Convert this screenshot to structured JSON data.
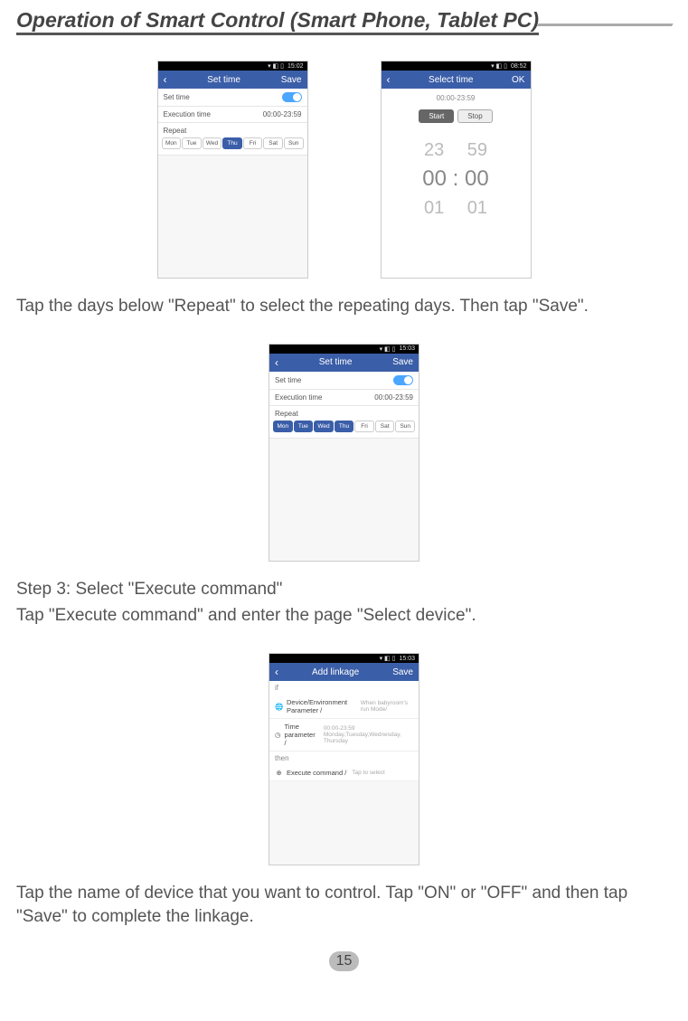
{
  "page_title": "Operation of Smart Control (Smart Phone, Tablet PC)",
  "page_number": "15",
  "texts": {
    "t1": "Tap the days below \"Repeat\" to select the repeating days. Then tap \"Save\".",
    "t2": "Step 3: Select \"Execute command\"",
    "t3": "Tap \"Execute command\" and enter the page \"Select device\".",
    "t4": "Tap the name of device that you want to control. Tap \"ON\" or \"OFF\" and then tap \"Save\" to complete the linkage."
  },
  "shot_a": {
    "status_time": "15:02",
    "title": "Set time",
    "save": "Save",
    "set_time_label": "Set time",
    "exec_label": "Execution time",
    "exec_value": "00:00-23:59",
    "repeat": "Repeat",
    "days": [
      "Mon",
      "Tue",
      "Wed",
      "Thu",
      "Fri",
      "Sat",
      "Sun"
    ],
    "selected": [
      false,
      false,
      false,
      true,
      false,
      false,
      false
    ]
  },
  "shot_b": {
    "status_time": "08:52",
    "title": "Select time",
    "ok": "OK",
    "range": "00:00-23:59",
    "start": "Start",
    "stop": "Stop",
    "wheel_up": "23  59",
    "wheel_mid": "00 : 00",
    "wheel_dn": "01  01"
  },
  "shot_c": {
    "status_time": "15:03",
    "title": "Set time",
    "save": "Save",
    "set_time_label": "Set time",
    "exec_label": "Execution time",
    "exec_value": "00:00-23:59",
    "repeat": "Repeat",
    "days": [
      "Mon",
      "Tue",
      "Wed",
      "Thu",
      "Fri",
      "Sat",
      "Sun"
    ],
    "selected": [
      true,
      true,
      true,
      true,
      false,
      false,
      false
    ]
  },
  "shot_d": {
    "status_time": "15:03",
    "title": "Add linkage",
    "save": "Save",
    "if": "if",
    "then": "then",
    "dev_env": "Device/Environment Parameter /",
    "dev_env_val": "When babyroom's run Mode/",
    "time_param": "Time parameter /",
    "time_param_val": "00:00-23:59 Monday,Tuesday,Wednesday, Thursday",
    "exec_cmd": "Execute command /",
    "exec_cmd_val": "Tap to select"
  }
}
